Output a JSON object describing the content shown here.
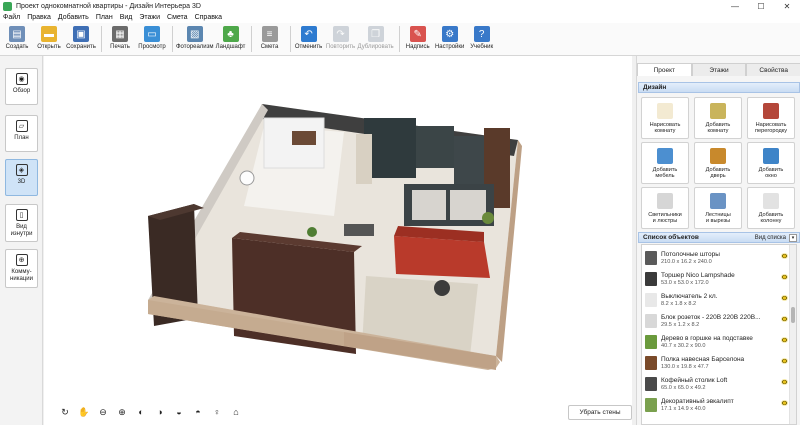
{
  "window": {
    "title": "Проект однокомнатной квартиры - Дизайн Интерьера 3D",
    "minimize": "—",
    "maximize": "☐",
    "close": "✕"
  },
  "menu": [
    "Файл",
    "Правка",
    "Добавить",
    "План",
    "Вид",
    "Этажи",
    "Смета",
    "Справка"
  ],
  "toolbar": [
    {
      "label": "Создать",
      "icon": "new-file-icon",
      "color": "#6f8fb8",
      "glyph": "▤"
    },
    {
      "label": "Открыть",
      "icon": "open-folder-icon",
      "color": "#e9b430",
      "glyph": "▬"
    },
    {
      "label": "Сохранить",
      "icon": "save-icon",
      "color": "#3f6fb5",
      "glyph": "▣"
    },
    {
      "label": "Печать",
      "icon": "printer-icon",
      "color": "#6b6b6b",
      "glyph": "▦"
    },
    {
      "label": "Просмотр",
      "icon": "monitor-icon",
      "color": "#3a8fd6",
      "glyph": "▭"
    },
    {
      "label": "Фотореализм",
      "icon": "photo-icon",
      "color": "#5b86b0",
      "glyph": "▨"
    },
    {
      "label": "Ландшафт",
      "icon": "landscape-icon",
      "color": "#4ea84a",
      "glyph": "♣"
    },
    {
      "label": "Смета",
      "icon": "estimate-icon",
      "color": "#9a9a9a",
      "glyph": "≡"
    },
    {
      "label": "Отменить",
      "icon": "undo-icon",
      "color": "#2e7bd0",
      "glyph": "↶"
    },
    {
      "label": "Повторить",
      "icon": "redo-icon",
      "color": "#9aa6b2",
      "glyph": "↷"
    },
    {
      "label": "Дублировать",
      "icon": "duplicate-icon",
      "color": "#9aa6b2",
      "glyph": "❐"
    },
    {
      "label": "Надпись",
      "icon": "label-brush-icon",
      "color": "#d9534f",
      "glyph": "✎"
    },
    {
      "label": "Настройки",
      "icon": "settings-gear-icon",
      "color": "#3979c9",
      "glyph": "⚙"
    },
    {
      "label": "Учебник",
      "icon": "help-icon",
      "color": "#3979c9",
      "glyph": "?"
    }
  ],
  "nav": [
    {
      "label": "Обзор",
      "icon": "eye-icon",
      "glyph": "◉"
    },
    {
      "label": "План",
      "icon": "plan-icon",
      "glyph": "▱"
    },
    {
      "label": "3D",
      "icon": "cube-icon",
      "glyph": "◈"
    },
    {
      "label": "Вид\nизнутри",
      "icon": "interior-view-icon",
      "glyph": "▯"
    },
    {
      "label": "Комму-\nникации",
      "icon": "communications-icon",
      "glyph": "⊕"
    }
  ],
  "viewport_tools": [
    {
      "name": "rotate-360-icon",
      "glyph": "↻"
    },
    {
      "name": "hand-pan-icon",
      "glyph": "✋"
    },
    {
      "name": "zoom-out-icon",
      "glyph": "⊖"
    },
    {
      "name": "zoom-in-icon",
      "glyph": "⊕"
    },
    {
      "name": "rotate-left-icon",
      "glyph": "◐"
    },
    {
      "name": "rotate-right-icon",
      "glyph": "◑"
    },
    {
      "name": "tilt-down-icon",
      "glyph": "◒"
    },
    {
      "name": "tilt-up-icon",
      "glyph": "◓"
    },
    {
      "name": "light-bulb-icon",
      "glyph": "♀"
    },
    {
      "name": "home-icon",
      "glyph": "⌂"
    }
  ],
  "remove_walls": "Убрать стены",
  "panel": {
    "tabs": [
      "Проект",
      "Этажи",
      "Свойства"
    ],
    "design_title": "Дизайн",
    "design_items": [
      {
        "label": "Нарисовать\nкомнату",
        "icon": "draw-room-icon",
        "color": "#f3ead2"
      },
      {
        "label": "Добавить\nкомнату",
        "icon": "add-room-icon",
        "color": "#c9b45b"
      },
      {
        "label": "Нарисовать\nперегородку",
        "icon": "draw-partition-icon",
        "color": "#b4473a"
      },
      {
        "label": "Добавить\nмебель",
        "icon": "add-furniture-icon",
        "color": "#4c8fd0"
      },
      {
        "label": "Добавить\nдверь",
        "icon": "add-door-icon",
        "color": "#c8892c"
      },
      {
        "label": "Добавить\nокно",
        "icon": "add-window-icon",
        "color": "#3e84c8"
      },
      {
        "label": "Светильники\nи люстры",
        "icon": "lamp-icon",
        "color": "#d6d6d6"
      },
      {
        "label": "Лестницы\nи вырезы",
        "icon": "stairs-icon",
        "color": "#6a93c4"
      },
      {
        "label": "Добавить\nколонну",
        "icon": "column-icon",
        "color": "#e2e2e2"
      }
    ],
    "objects_title": "Список объектов",
    "objects_view": "Вид списка",
    "objects": [
      {
        "name": "Потолочные шторы",
        "dims": "210.0 x 16.2 x 240.0",
        "icon": "curtains-icon",
        "color": "#5a5a5a"
      },
      {
        "name": "Торшер Nico Lampshade",
        "dims": "53.0 x 53.0 x 172.0",
        "icon": "floor-lamp-icon",
        "color": "#3a3a3a"
      },
      {
        "name": "Выключатель 2 кл.",
        "dims": "8.2 x 1.8 x 8.2",
        "icon": "switch-icon",
        "color": "#e8e8e8"
      },
      {
        "name": "Блок розеток - 220В 220В 220В...",
        "dims": "29.5 x 1.2 x 8.2",
        "icon": "socket-block-icon",
        "color": "#d8d8d8"
      },
      {
        "name": "Дерево в горшке на подставке",
        "dims": "40.7 x 30.2 x 90.0",
        "icon": "potted-tree-icon",
        "color": "#6a9a3c"
      },
      {
        "name": "Полка навесная Барселона",
        "dims": "130.0 x 19.8 x 47.7",
        "icon": "shelf-icon",
        "color": "#7a4a2a"
      },
      {
        "name": "Кофейный столик Loft",
        "dims": "65.0 x 65.0 x 49.2",
        "icon": "coffee-table-icon",
        "color": "#4a4a4a"
      },
      {
        "name": "Декоративный эвкалипт",
        "dims": "17.1 x 14.9 x 40.0",
        "icon": "eucalyptus-icon",
        "color": "#7aa04e"
      }
    ]
  }
}
